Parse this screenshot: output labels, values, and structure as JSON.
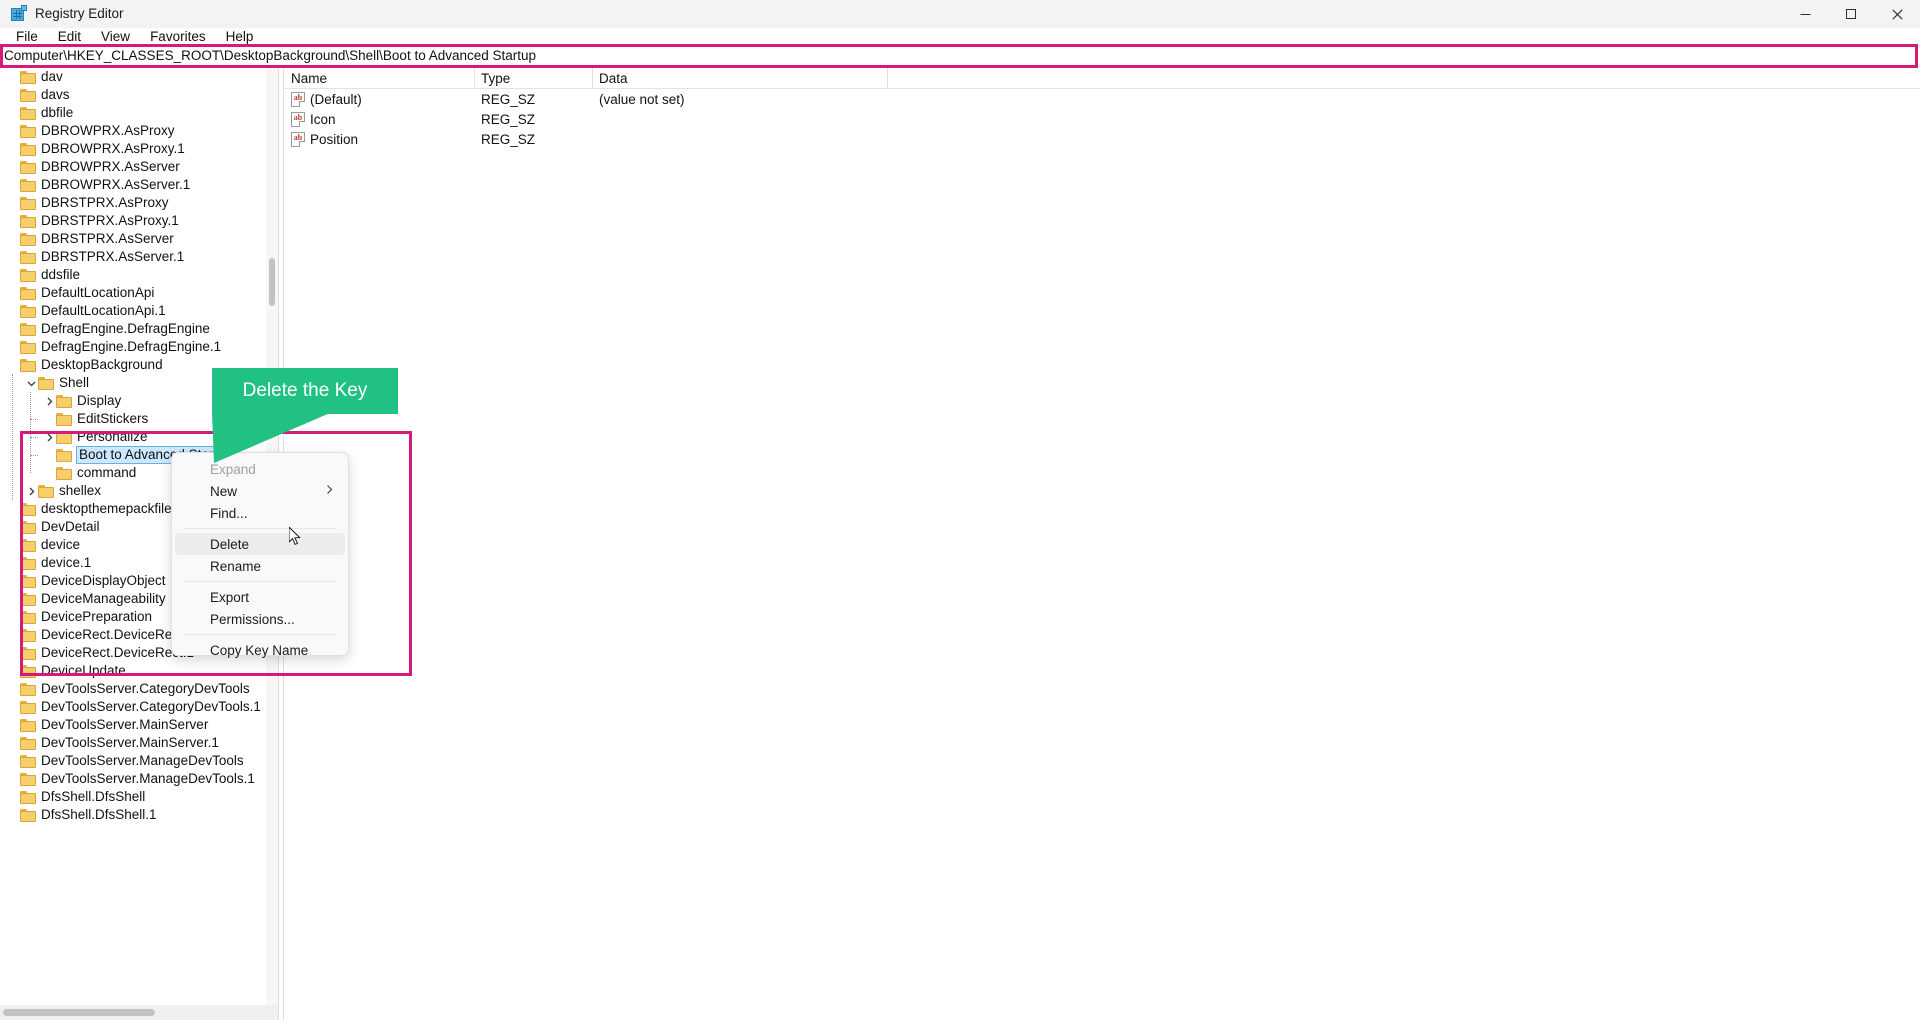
{
  "window": {
    "title": "Registry Editor",
    "icon": "registry-editor-icon",
    "controls": [
      {
        "name": "minimize",
        "glyph": "minimize-icon"
      },
      {
        "name": "maximize",
        "glyph": "maximize-icon"
      },
      {
        "name": "close",
        "glyph": "close-icon"
      }
    ]
  },
  "menubar": {
    "items": [
      {
        "label": "File"
      },
      {
        "label": "Edit"
      },
      {
        "label": "View"
      },
      {
        "label": "Favorites"
      },
      {
        "label": "Help"
      }
    ]
  },
  "address": {
    "value": "Computer\\HKEY_CLASSES_ROOT\\DesktopBackground\\Shell\\Boot to Advanced Startup",
    "highlight_color": "#d41a7a"
  },
  "tree": {
    "items": [
      {
        "label": "dav",
        "depth": 0,
        "twisty": "none"
      },
      {
        "label": "davs",
        "depth": 0,
        "twisty": "none"
      },
      {
        "label": "dbfile",
        "depth": 0,
        "twisty": "none"
      },
      {
        "label": "DBROWPRX.AsProxy",
        "depth": 0,
        "twisty": "none"
      },
      {
        "label": "DBROWPRX.AsProxy.1",
        "depth": 0,
        "twisty": "none"
      },
      {
        "label": "DBROWPRX.AsServer",
        "depth": 0,
        "twisty": "none"
      },
      {
        "label": "DBROWPRX.AsServer.1",
        "depth": 0,
        "twisty": "none"
      },
      {
        "label": "DBRSTPRX.AsProxy",
        "depth": 0,
        "twisty": "none"
      },
      {
        "label": "DBRSTPRX.AsProxy.1",
        "depth": 0,
        "twisty": "none"
      },
      {
        "label": "DBRSTPRX.AsServer",
        "depth": 0,
        "twisty": "none"
      },
      {
        "label": "DBRSTPRX.AsServer.1",
        "depth": 0,
        "twisty": "none"
      },
      {
        "label": "ddsfile",
        "depth": 0,
        "twisty": "none"
      },
      {
        "label": "DefaultLocationApi",
        "depth": 0,
        "twisty": "none"
      },
      {
        "label": "DefaultLocationApi.1",
        "depth": 0,
        "twisty": "none"
      },
      {
        "label": "DefragEngine.DefragEngine",
        "depth": 0,
        "twisty": "none"
      },
      {
        "label": "DefragEngine.DefragEngine.1",
        "depth": 0,
        "twisty": "none"
      },
      {
        "label": "DesktopBackground",
        "depth": 0,
        "twisty": "none"
      },
      {
        "label": "Shell",
        "depth": 1,
        "twisty": "expanded"
      },
      {
        "label": "Display",
        "depth": 2,
        "twisty": "collapsed"
      },
      {
        "label": "EditStickers",
        "depth": 2,
        "twisty": "none"
      },
      {
        "label": "Personalize",
        "depth": 2,
        "twisty": "collapsed"
      },
      {
        "label": "Boot to Advanced Startup",
        "depth": 2,
        "twisty": "none",
        "selected": true
      },
      {
        "label": "command",
        "depth": 2,
        "twisty": "none"
      },
      {
        "label": "shellex",
        "depth": 1,
        "twisty": "collapsed"
      },
      {
        "label": "desktopthemepackfile",
        "depth": 0,
        "twisty": "none"
      },
      {
        "label": "DevDetail",
        "depth": 0,
        "twisty": "none"
      },
      {
        "label": "device",
        "depth": 0,
        "twisty": "none"
      },
      {
        "label": "device.1",
        "depth": 0,
        "twisty": "none"
      },
      {
        "label": "DeviceDisplayObject",
        "depth": 0,
        "twisty": "none"
      },
      {
        "label": "DeviceManageability",
        "depth": 0,
        "twisty": "none"
      },
      {
        "label": "DevicePreparation",
        "depth": 0,
        "twisty": "none"
      },
      {
        "label": "DeviceRect.DeviceRect",
        "depth": 0,
        "twisty": "none"
      },
      {
        "label": "DeviceRect.DeviceRect.1",
        "depth": 0,
        "twisty": "none"
      },
      {
        "label": "DeviceUpdate",
        "depth": 0,
        "twisty": "none"
      },
      {
        "label": "DevToolsServer.CategoryDevTools",
        "depth": 0,
        "twisty": "none"
      },
      {
        "label": "DevToolsServer.CategoryDevTools.1",
        "depth": 0,
        "twisty": "none"
      },
      {
        "label": "DevToolsServer.MainServer",
        "depth": 0,
        "twisty": "none"
      },
      {
        "label": "DevToolsServer.MainServer.1",
        "depth": 0,
        "twisty": "none"
      },
      {
        "label": "DevToolsServer.ManageDevTools",
        "depth": 0,
        "twisty": "none"
      },
      {
        "label": "DevToolsServer.ManageDevTools.1",
        "depth": 0,
        "twisty": "none"
      },
      {
        "label": "DfsShell.DfsShell",
        "depth": 0,
        "twisty": "none"
      },
      {
        "label": "DfsShell.DfsShell.1",
        "depth": 0,
        "twisty": "none"
      }
    ]
  },
  "values": {
    "columns": [
      "Name",
      "Type",
      "Data"
    ],
    "rows": [
      {
        "name": "(Default)",
        "type": "REG_SZ",
        "data": "(value not set)",
        "icon": "string-value-icon"
      },
      {
        "name": "Icon",
        "type": "REG_SZ",
        "data": "",
        "icon": "string-value-icon"
      },
      {
        "name": "Position",
        "type": "REG_SZ",
        "data": "",
        "icon": "string-value-icon"
      }
    ]
  },
  "context_menu": {
    "items": [
      {
        "label": "Expand",
        "disabled": true,
        "separator_after": false
      },
      {
        "label": "New",
        "submenu": "chevron-right-icon",
        "separator_after": false
      },
      {
        "label": "Find...",
        "separator_after": true
      },
      {
        "label": "Delete",
        "hover": true,
        "separator_after": false
      },
      {
        "label": "Rename",
        "separator_after": true
      },
      {
        "label": "Export",
        "separator_after": false
      },
      {
        "label": "Permissions...",
        "separator_after": true
      },
      {
        "label": "Copy Key Name",
        "separator_after": false
      }
    ]
  },
  "annotation": {
    "callout_text": "Delete the Key",
    "callout_color": "#21c183",
    "box_color": "#d41a7a"
  }
}
